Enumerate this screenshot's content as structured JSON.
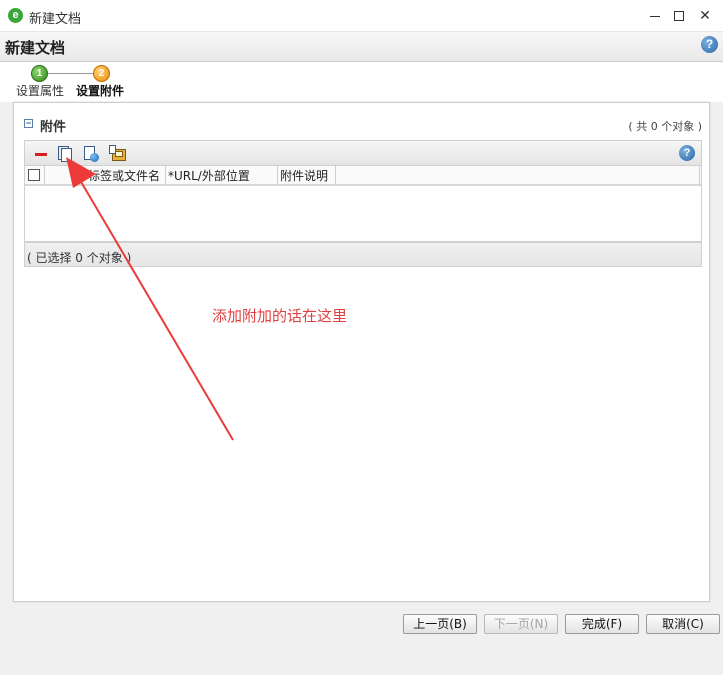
{
  "window": {
    "title": "新建文档",
    "app_icon": "e",
    "min_glyph": "",
    "max_glyph": "",
    "close_glyph": "✕"
  },
  "header": {
    "title": "新建文档",
    "help_glyph": "?"
  },
  "wizard": {
    "steps": [
      {
        "number": "1",
        "label": "设置属性",
        "state": "completed",
        "color": "#3a9a2a"
      },
      {
        "number": "2",
        "label": "设置附件",
        "state": "current",
        "color": "#f08a00"
      }
    ]
  },
  "attachments": {
    "section_title": "附件",
    "collapse_glyph": "−",
    "total_count_text": "( 共 0 个对象 )",
    "toolbar": {
      "icons": [
        "remove-icon",
        "add-file-icon",
        "add-url-icon",
        "paste-attachment-icon"
      ],
      "help_glyph": "?"
    },
    "columns": [
      "",
      "",
      "*标签或文件名",
      "*URL/外部位置",
      "附件说明",
      ""
    ],
    "rows": [],
    "selection_text": "( 已选择 0 个对象 )"
  },
  "annotation": {
    "text": "添加附加的话在这里",
    "color": "#e04040"
  },
  "footer": {
    "prev_label": "上一页(B)",
    "next_label": "下一页(N)",
    "finish_label": "完成(F)",
    "cancel_label": "取消(C)"
  }
}
